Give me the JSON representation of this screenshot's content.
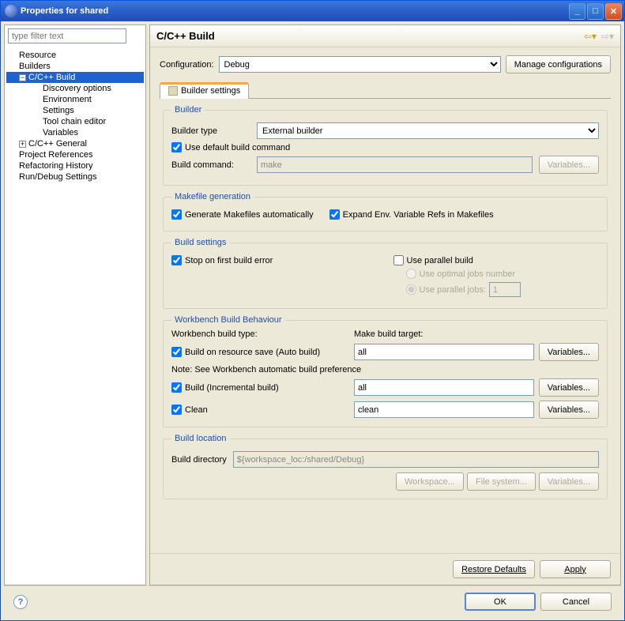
{
  "window": {
    "title": "Properties for shared"
  },
  "filter": {
    "placeholder": "type filter text"
  },
  "tree": {
    "items": [
      {
        "label": "Resource"
      },
      {
        "label": "Builders"
      },
      {
        "label": "C/C++ Build"
      },
      {
        "label": "Discovery options"
      },
      {
        "label": "Environment"
      },
      {
        "label": "Settings"
      },
      {
        "label": "Tool chain editor"
      },
      {
        "label": "Variables"
      },
      {
        "label": "C/C++ General"
      },
      {
        "label": "Project References"
      },
      {
        "label": "Refactoring History"
      },
      {
        "label": "Run/Debug Settings"
      }
    ]
  },
  "page": {
    "title": "C/C++ Build",
    "config_label": "Configuration:",
    "config_value": "Debug",
    "manage_config": "Manage configurations",
    "tab_label": "Builder settings"
  },
  "builder": {
    "legend": "Builder",
    "type_label": "Builder type",
    "type_value": "External builder",
    "use_default_cmd": "Use default build command",
    "build_cmd_label": "Build command:",
    "build_cmd_value": "make",
    "variables_btn": "Variables..."
  },
  "makefile": {
    "legend": "Makefile generation",
    "generate": "Generate Makefiles automatically",
    "expand_env": "Expand Env. Variable Refs in Makefiles"
  },
  "build_settings": {
    "legend": "Build settings",
    "stop_on_error": "Stop on first build error",
    "use_parallel": "Use parallel build",
    "optimal_jobs": "Use optimal jobs number",
    "parallel_jobs": "Use parallel jobs:",
    "jobs_value": "1"
  },
  "workbench": {
    "legend": "Workbench Build Behaviour",
    "type_header": "Workbench build type:",
    "target_header": "Make build target:",
    "auto_build": "Build on resource save (Auto build)",
    "auto_target": "all",
    "note": "Note: See Workbench automatic build preference",
    "incremental": "Build (Incremental build)",
    "incremental_target": "all",
    "clean": "Clean",
    "clean_target": "clean",
    "variables_btn": "Variables..."
  },
  "location": {
    "legend": "Build location",
    "dir_label": "Build directory",
    "dir_value": "${workspace_loc:/shared/Debug}",
    "workspace_btn": "Workspace...",
    "filesystem_btn": "File system...",
    "variables_btn": "Variables..."
  },
  "footer": {
    "restore": "Restore Defaults",
    "apply": "Apply",
    "ok": "OK",
    "cancel": "Cancel"
  }
}
